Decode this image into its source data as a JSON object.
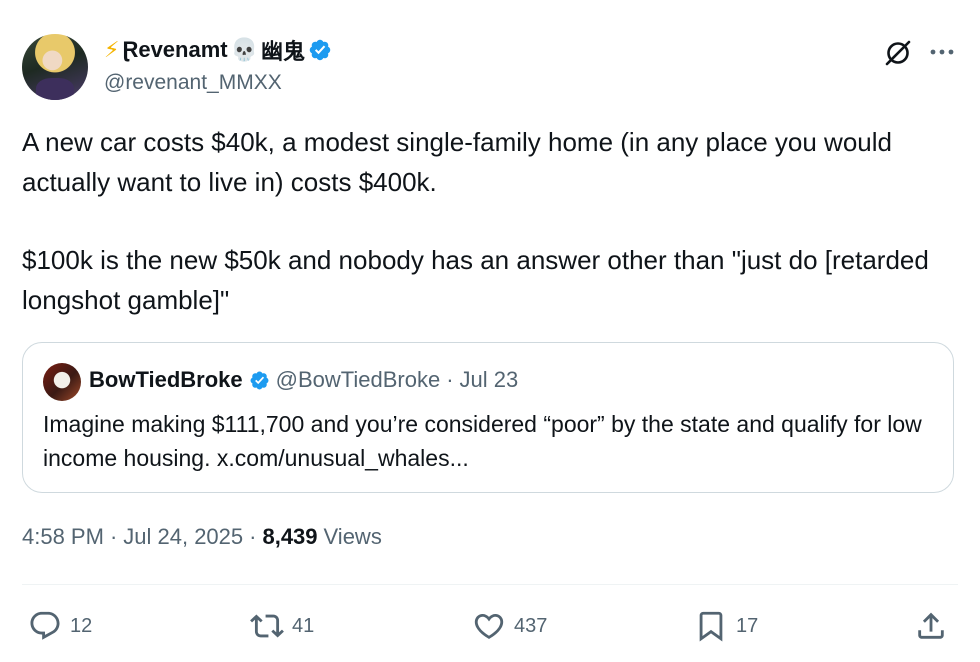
{
  "author": {
    "display_name": "Ɽevenamt",
    "prefix_emoji": "⚡",
    "suffix_emoji": "💀",
    "suffix_text": "幽鬼",
    "handle": "@revenant_MMXX",
    "verified": true
  },
  "tweet": {
    "paragraphs": [
      "A new car costs $40k, a modest single-family home (in any place you would actually want to live in) costs $400k.",
      "$100k is the new $50k and nobody has an answer other than \"just do [retarded longshot gamble]\""
    ]
  },
  "quote": {
    "name": "BowTiedBroke",
    "handle": "@BowTiedBroke",
    "separator": "·",
    "date": "Jul 23",
    "verified": true,
    "text": "Imagine making $111,700 and you’re considered “poor” by the state and qualify for low income housing. x.com/unusual_whales..."
  },
  "meta": {
    "time": "4:58 PM",
    "separator": "·",
    "date": "Jul 24, 2025",
    "views_count": "8,439",
    "views_label": "Views"
  },
  "actions": {
    "replies": "12",
    "reposts": "41",
    "likes": "437",
    "bookmarks": "17"
  },
  "colors": {
    "verified_blue": "#1d9bf0",
    "secondary_text": "#536471",
    "primary_text": "#0f1419",
    "border": "#cfd9de"
  },
  "icons": [
    "grok-icon",
    "more-icon",
    "reply-icon",
    "repost-icon",
    "like-icon",
    "bookmark-icon",
    "share-icon",
    "verified-badge-icon"
  ]
}
